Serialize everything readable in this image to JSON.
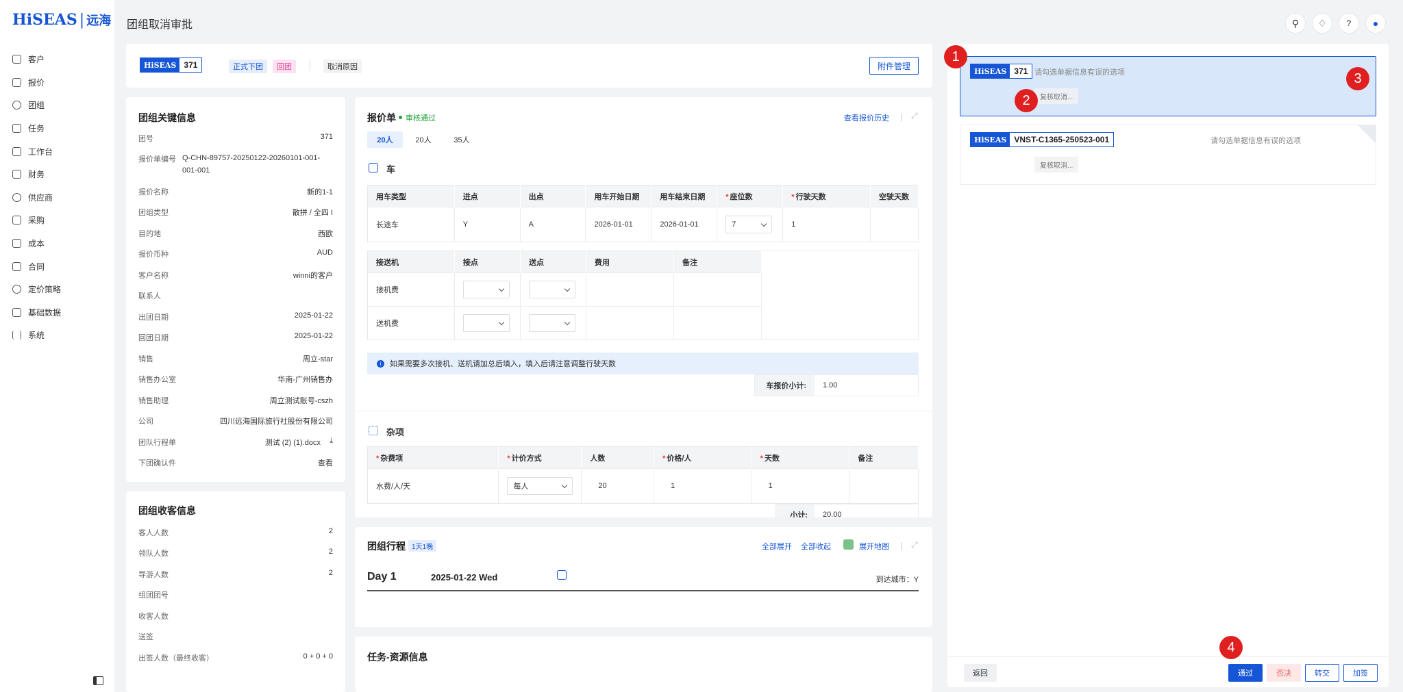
{
  "sidebar": {
    "logo_brand": "HiSEAS",
    "logo_cn": "远海",
    "items": [
      {
        "label": "客户",
        "icon": "customer-icon"
      },
      {
        "label": "报价",
        "icon": "quote-icon"
      },
      {
        "label": "团组",
        "icon": "group-icon"
      },
      {
        "label": "任务",
        "icon": "task-icon"
      },
      {
        "label": "工作台",
        "icon": "workbench-icon"
      },
      {
        "label": "财务",
        "icon": "finance-icon"
      },
      {
        "label": "供应商",
        "icon": "supplier-icon"
      },
      {
        "label": "采购",
        "icon": "purchase-icon"
      },
      {
        "label": "成本",
        "icon": "cost-icon"
      },
      {
        "label": "合同",
        "icon": "contract-icon"
      },
      {
        "label": "定价策略",
        "icon": "pricing-icon"
      },
      {
        "label": "基础数据",
        "icon": "basedata-icon"
      },
      {
        "label": "系统",
        "icon": "system-icon"
      }
    ]
  },
  "header": {
    "title": "团组取消审批"
  },
  "summary": {
    "brand": "HiSEAS",
    "group_no": "371",
    "tag_formal": "正式下团",
    "tag_return": "回团",
    "cancel_reason": "取消原因",
    "attach_btn": "附件管理"
  },
  "key_info": {
    "title": "团组关键信息",
    "rows": [
      {
        "k": "团号",
        "v": "371"
      },
      {
        "k": "报价单编号",
        "v": "Q-CHN-89757-20250122-20260101-001-001-001"
      },
      {
        "k": "报价名称",
        "v": "新的1-1"
      },
      {
        "k": "团组类型",
        "v": "散拼 / 全四 I"
      },
      {
        "k": "目的地",
        "v": "西欧"
      },
      {
        "k": "报价币种",
        "v": "AUD"
      },
      {
        "k": "客户名称",
        "v": "winni的客户"
      },
      {
        "k": "联系人",
        "v": ""
      },
      {
        "k": "出团日期",
        "v": "2025-01-22"
      },
      {
        "k": "回团日期",
        "v": "2025-01-22"
      },
      {
        "k": "销售",
        "v": "周立-star"
      },
      {
        "k": "销售办公室",
        "v": "华南-广州销售办"
      },
      {
        "k": "销售助理",
        "v": "周立测试账号-cszh"
      },
      {
        "k": "公司",
        "v": "四川远海国际旅行社股份有限公司"
      },
      {
        "k": "团队行程单",
        "v": "测试 (2) (1).docx"
      },
      {
        "k": "下团确认件",
        "v": "查看"
      }
    ]
  },
  "guest_info": {
    "title": "团组收客信息",
    "rows": [
      {
        "k": "客人人数",
        "v": "2"
      },
      {
        "k": "领队人数",
        "v": "2"
      },
      {
        "k": "导游人数",
        "v": "2"
      },
      {
        "k": "组团团号",
        "v": ""
      },
      {
        "k": "收客人数",
        "v": ""
      },
      {
        "k": "送签",
        "v": ""
      },
      {
        "k": "出签人数（最终收客）",
        "v": "0 + 0 + 0"
      }
    ]
  },
  "quote": {
    "title": "报价单",
    "status": "审核通过",
    "history": "查看报价历史",
    "tabs": [
      "20人",
      "20人",
      "35人"
    ],
    "car": {
      "title": "车",
      "headers": [
        "用车类型",
        "进点",
        "出点",
        "用车开始日期",
        "用车结束日期",
        "座位数",
        "行驶天数",
        "空驶天数"
      ],
      "row": [
        "长途车",
        "Y",
        "A",
        "2026-01-01",
        "2026-01-01",
        "7",
        "1",
        ""
      ],
      "transfer_headers": [
        "接送机",
        "接点",
        "送点",
        "费用",
        "备注"
      ],
      "transfer_rows": [
        "接机费",
        "送机费"
      ],
      "notice": "如果需要多次接机、送机请加总后填入，填入后请注意调整行驶天数",
      "subtotal_label": "车报价小计:",
      "subtotal": "1.00"
    },
    "misc": {
      "title": "杂项",
      "headers": [
        "杂费项",
        "计价方式",
        "人数",
        "价格/人",
        "天数",
        "备注"
      ],
      "row": [
        "水费/人/天",
        "每人",
        "20",
        "1",
        "1",
        ""
      ],
      "subtotal_label": "小计:",
      "subtotal": "20.00"
    }
  },
  "itinerary": {
    "title": "团组行程",
    "tag": "1天1晚",
    "expand": "全部展开",
    "collapse": "全部收起",
    "map": "展开地图",
    "day": "Day 1",
    "date": "2025-01-22 Wed",
    "arrive": "到达城市：Y"
  },
  "task": {
    "title": "任务-资源信息"
  },
  "approvals": [
    {
      "brand": "HiSEAS",
      "no": "371",
      "hint": "请勾选单据信息有误的选项",
      "action": "复核取消..."
    },
    {
      "brand": "HiSEAS",
      "no": "VNST-C1365-250523-001",
      "hint": "请勾选单据信息有误的选项",
      "action": "复核取消..."
    }
  ],
  "footer": {
    "back": "返回",
    "pass": "通过",
    "reject": "否决",
    "transfer": "转交",
    "add_sign": "加签"
  },
  "badges": [
    "1",
    "2",
    "3",
    "4"
  ],
  "colors": {
    "primary": "#1656d6",
    "success": "#22a33a",
    "danger": "#e02020"
  }
}
